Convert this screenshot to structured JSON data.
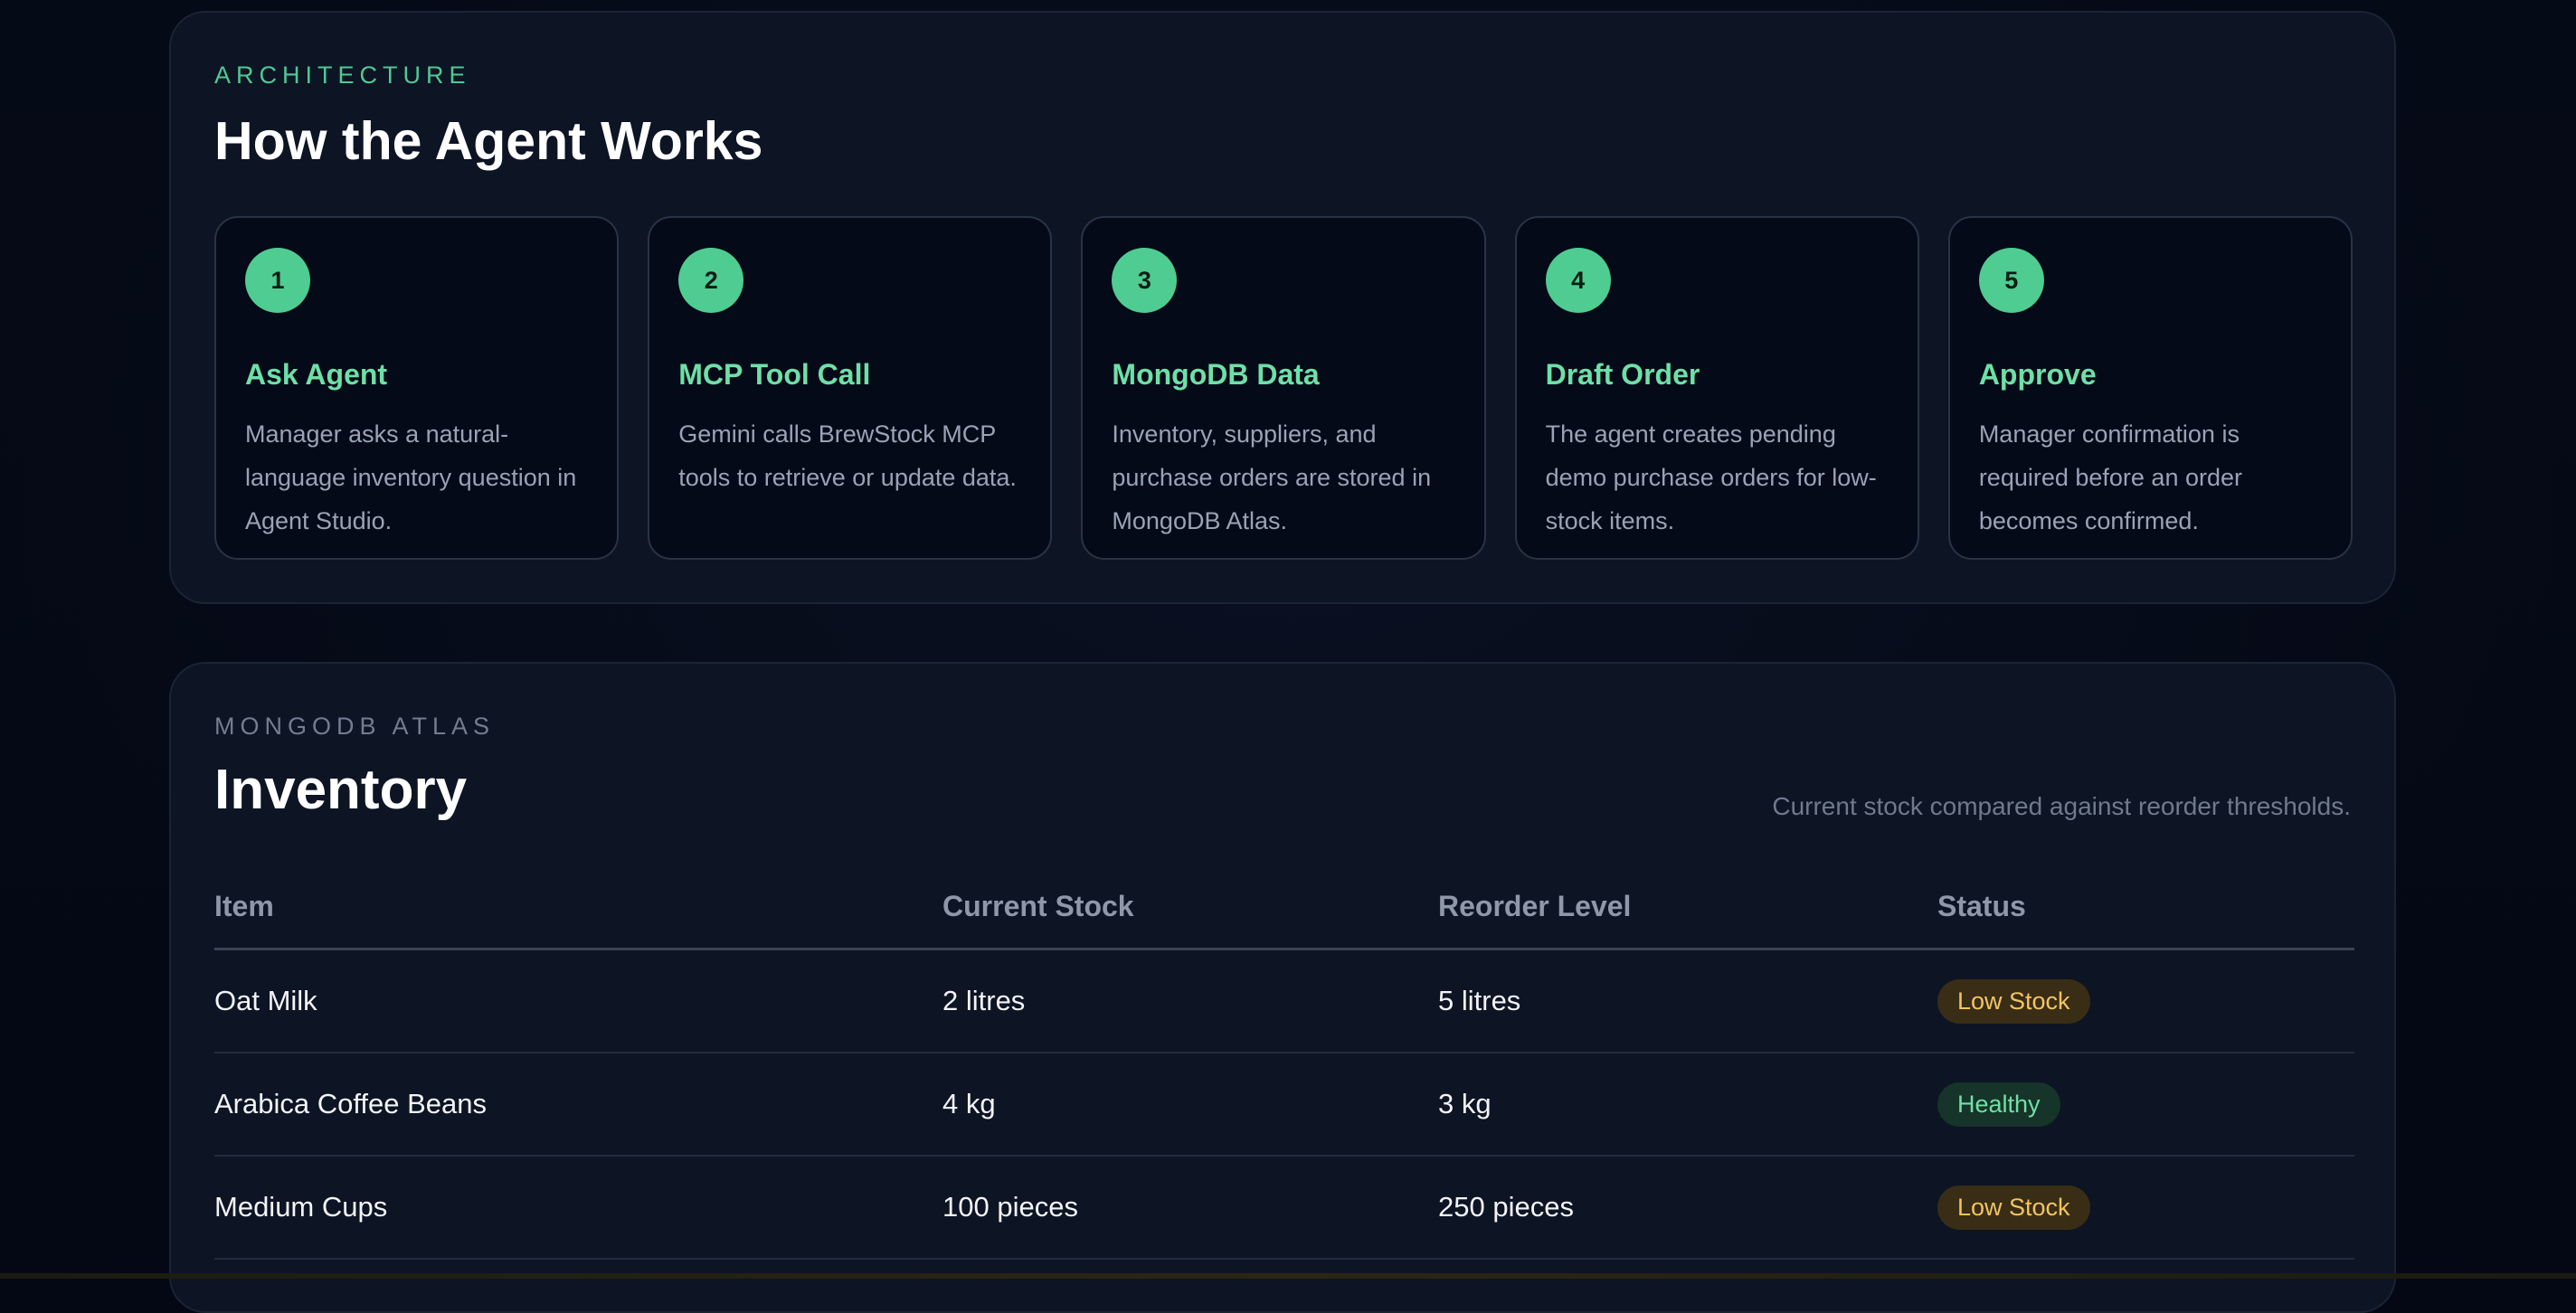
{
  "architecture": {
    "eyebrow": "ARCHITECTURE",
    "title": "How the Agent Works",
    "steps": [
      {
        "number": "1",
        "title": "Ask Agent",
        "description": "Manager asks a natural-language inventory question in Agent Studio."
      },
      {
        "number": "2",
        "title": "MCP Tool Call",
        "description": "Gemini calls BrewStock MCP tools to retrieve or update data."
      },
      {
        "number": "3",
        "title": "MongoDB Data",
        "description": "Inventory, suppliers, and purchase orders are stored in MongoDB Atlas."
      },
      {
        "number": "4",
        "title": "Draft Order",
        "description": "The agent creates pending demo purchase orders for low-stock items."
      },
      {
        "number": "5",
        "title": "Approve",
        "description": "Manager confirmation is required before an order becomes confirmed."
      }
    ]
  },
  "inventory": {
    "eyebrow": "MONGODB ATLAS",
    "title": "Inventory",
    "subtitle": "Current stock compared against reorder thresholds.",
    "columns": [
      "Item",
      "Current Stock",
      "Reorder Level",
      "Status"
    ],
    "rows": [
      {
        "item": "Oat Milk",
        "current_stock": "2 litres",
        "reorder_level": "5 litres",
        "status": "Low Stock",
        "status_kind": "low"
      },
      {
        "item": "Arabica Coffee Beans",
        "current_stock": "4 kg",
        "reorder_level": "3 kg",
        "status": "Healthy",
        "status_kind": "ok"
      },
      {
        "item": "Medium Cups",
        "current_stock": "100 pieces",
        "reorder_level": "250 pieces",
        "status": "Low Stock",
        "status_kind": "low"
      }
    ]
  },
  "colors": {
    "accent_green": "#4fcc91",
    "low_stock_text": "#f2c55e",
    "healthy_text": "#6ee0a7",
    "background": "#040814",
    "card": "#0d1424"
  }
}
